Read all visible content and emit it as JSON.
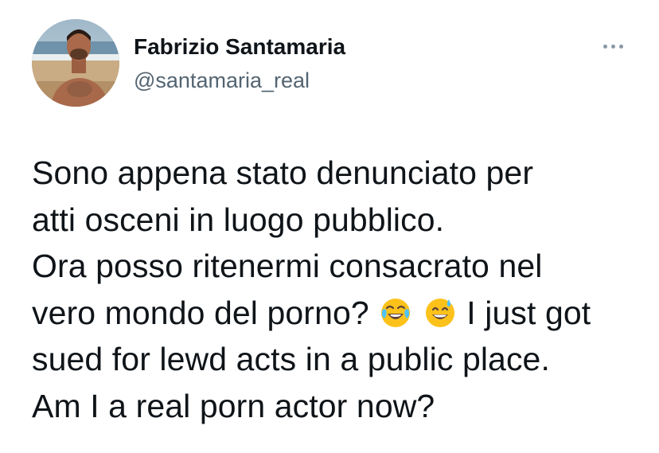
{
  "tweet": {
    "author": {
      "display_name": "Fabrizio Santamaria",
      "handle": "@santamaria_real",
      "avatar_icon": "profile-photo-beach"
    },
    "more_icon": "ellipsis-icon",
    "text_lines": [
      "Sono appena stato denunciato per",
      "atti osceni in luogo pubblico.",
      "Ora posso ritenermi consacrato nel",
      "vero mondo del porno?",
      "I just got",
      "sued for lewd acts in a public place.",
      "Am I a real porn actor now?"
    ],
    "emojis": [
      "face-with-tears-of-joy",
      "grinning-face-with-sweat"
    ]
  },
  "colors": {
    "text": "#0f1419",
    "secondary_text": "#536471",
    "icon_gray": "#8b98a5",
    "emoji_yellow": "#fcc21b"
  }
}
